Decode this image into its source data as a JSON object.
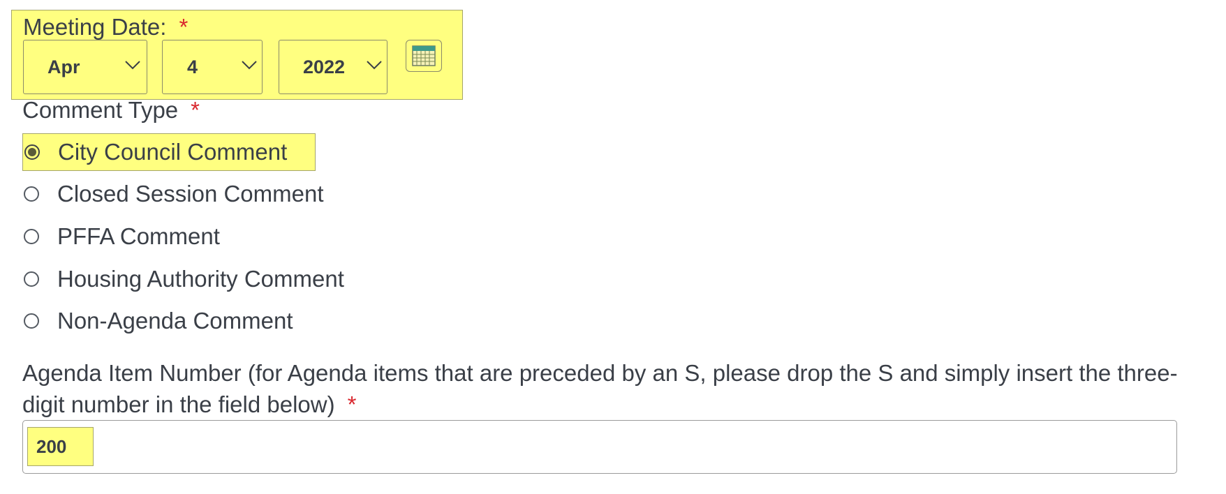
{
  "meeting_date": {
    "label": "Meeting Date:",
    "required_mark": "*",
    "month": "Apr",
    "day": "4",
    "year": "2022",
    "calendar_icon": "calendar-icon"
  },
  "comment_type": {
    "label": "Comment Type",
    "required_mark": "*",
    "options": [
      {
        "label": "City Council Comment",
        "selected": true
      },
      {
        "label": "Closed Session Comment",
        "selected": false
      },
      {
        "label": "PFFA Comment",
        "selected": false
      },
      {
        "label": "Housing Authority Comment",
        "selected": false
      },
      {
        "label": "Non-Agenda Comment",
        "selected": false
      }
    ]
  },
  "agenda_item": {
    "label": "Agenda Item Number (for Agenda items that are preceded by an S, please drop the S and simply insert the three-digit number in the field below)",
    "required_mark": "*",
    "value": "200"
  },
  "colors": {
    "highlight": "#ffff80",
    "required": "#d9282f",
    "text": "#3a3f47"
  }
}
